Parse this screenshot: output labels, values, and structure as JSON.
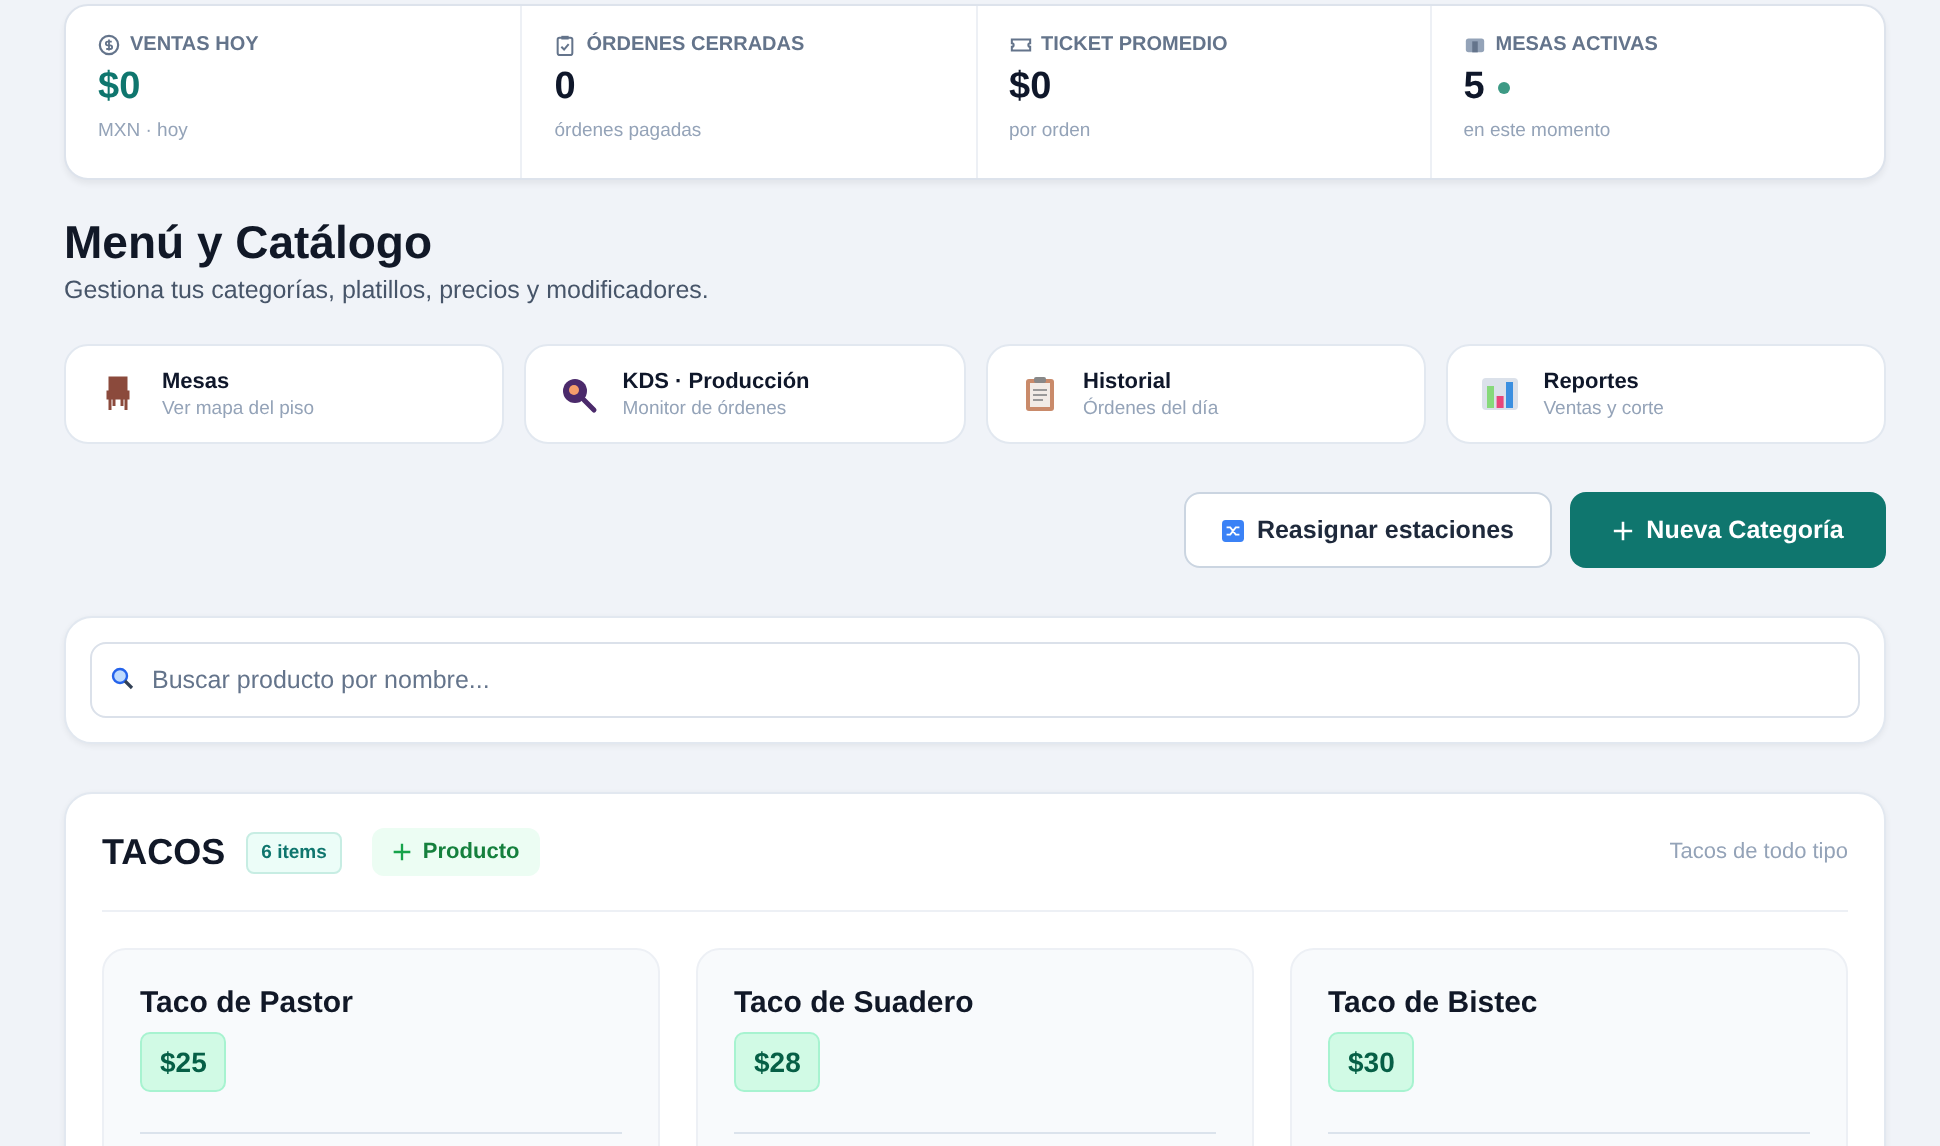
{
  "stats": [
    {
      "label": "VENTAS HOY",
      "value": "$0",
      "caption": "MXN · hoy",
      "accent": true,
      "live": false
    },
    {
      "label": "ÓRDENES CERRADAS",
      "value": "0",
      "caption": "órdenes pagadas",
      "accent": false,
      "live": false
    },
    {
      "label": "TICKET PROMEDIO",
      "value": "$0",
      "caption": "por orden",
      "accent": false,
      "live": false
    },
    {
      "label": "MESAS ACTIVAS",
      "value": "5",
      "caption": "en este momento",
      "accent": false,
      "live": true
    }
  ],
  "page": {
    "title": "Menú y Catálogo",
    "subtitle": "Gestiona tus categorías, platillos, precios y modificadores."
  },
  "shortcuts": [
    {
      "title": "Mesas",
      "caption": "Ver mapa del piso"
    },
    {
      "title": "KDS · Producción",
      "caption": "Monitor de órdenes"
    },
    {
      "title": "Historial",
      "caption": "Órdenes del día"
    },
    {
      "title": "Reportes",
      "caption": "Ventas y corte"
    }
  ],
  "actions": {
    "secondary": "Reasignar estaciones",
    "primary": "Nueva Categoría"
  },
  "search": {
    "placeholder": "Buscar producto por nombre..."
  },
  "category": {
    "name": "TACOS",
    "count": "6 items",
    "add_label": "Producto",
    "description": "Tacos de todo tipo",
    "products": [
      {
        "name": "Taco de Pastor",
        "price": "$25"
      },
      {
        "name": "Taco de Suadero",
        "price": "$28"
      },
      {
        "name": "Taco de Bistec",
        "price": "$30"
      }
    ]
  }
}
